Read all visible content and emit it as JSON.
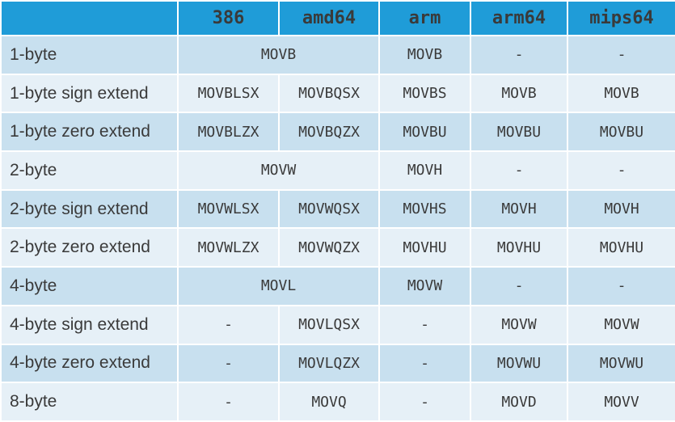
{
  "headers": [
    "",
    "386",
    "amd64",
    "arm",
    "arm64",
    "mips64"
  ],
  "rows": [
    {
      "label": "1-byte",
      "cells": [
        {
          "text": "MOVB",
          "span": 2
        },
        {
          "text": "MOVB"
        },
        {
          "text": "-"
        },
        {
          "text": "-"
        }
      ]
    },
    {
      "label": "1-byte sign extend",
      "cells": [
        {
          "text": "MOVBLSX"
        },
        {
          "text": "MOVBQSX"
        },
        {
          "text": "MOVBS"
        },
        {
          "text": "MOVB"
        },
        {
          "text": "MOVB"
        }
      ]
    },
    {
      "label": "1-byte zero extend",
      "cells": [
        {
          "text": "MOVBLZX"
        },
        {
          "text": "MOVBQZX"
        },
        {
          "text": "MOVBU"
        },
        {
          "text": "MOVBU"
        },
        {
          "text": "MOVBU"
        }
      ]
    },
    {
      "label": "2-byte",
      "cells": [
        {
          "text": "MOVW",
          "span": 2
        },
        {
          "text": "MOVH"
        },
        {
          "text": "-"
        },
        {
          "text": "-"
        }
      ]
    },
    {
      "label": "2-byte sign extend",
      "cells": [
        {
          "text": "MOVWLSX"
        },
        {
          "text": "MOVWQSX"
        },
        {
          "text": "MOVHS"
        },
        {
          "text": "MOVH"
        },
        {
          "text": "MOVH"
        }
      ]
    },
    {
      "label": "2-byte zero extend",
      "cells": [
        {
          "text": "MOVWLZX"
        },
        {
          "text": "MOVWQZX"
        },
        {
          "text": "MOVHU"
        },
        {
          "text": "MOVHU"
        },
        {
          "text": "MOVHU"
        }
      ]
    },
    {
      "label": "4-byte",
      "cells": [
        {
          "text": "MOVL",
          "span": 2
        },
        {
          "text": "MOVW"
        },
        {
          "text": "-"
        },
        {
          "text": "-"
        }
      ]
    },
    {
      "label": "4-byte sign extend",
      "cells": [
        {
          "text": "-"
        },
        {
          "text": "MOVLQSX"
        },
        {
          "text": "-"
        },
        {
          "text": "MOVW"
        },
        {
          "text": "MOVW"
        }
      ]
    },
    {
      "label": "4-byte zero extend",
      "cells": [
        {
          "text": "-"
        },
        {
          "text": "MOVLQZX"
        },
        {
          "text": "-"
        },
        {
          "text": "MOVWU"
        },
        {
          "text": "MOVWU"
        }
      ]
    },
    {
      "label": "8-byte",
      "cells": [
        {
          "text": "-"
        },
        {
          "text": "MOVQ"
        },
        {
          "text": "-"
        },
        {
          "text": "MOVD"
        },
        {
          "text": "MOVV"
        }
      ]
    }
  ],
  "colors": {
    "header": "#1f9cd8",
    "row_dark": "#c8e0ef",
    "row_light": "#e6f0f7",
    "text": "#3a3a3a"
  }
}
